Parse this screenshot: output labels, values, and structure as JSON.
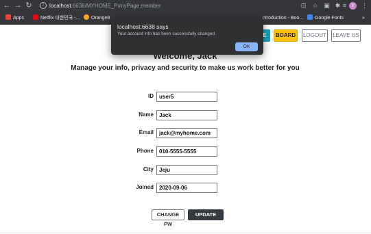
{
  "browser": {
    "url_host": "localhost",
    "url_rest": ":6638/MYHOME_P/myPage.member",
    "bookmarks": [
      {
        "label": "Apps",
        "color": "#e8453c"
      },
      {
        "label": "Netflix 대한민국 -...",
        "color": "#e50914"
      },
      {
        "label": "Orange8",
        "color": "#f5a623"
      },
      {
        "label": "ntroduction - Boo...",
        "color": ""
      },
      {
        "label": "Google Fonts",
        "color": "#4285f4"
      }
    ],
    "overflow": "»",
    "profile_initial": "Y"
  },
  "nav": {
    "teal_label": "E",
    "board_label": "BOARD",
    "logout_label": "LOGOUT",
    "leave_label": "LEAVE US"
  },
  "page": {
    "welcome": "Welcome, Jack",
    "subtitle": "Manage your info, privacy and security to make us work better for you"
  },
  "form": {
    "fields": [
      {
        "label": "ID",
        "value": "user5"
      },
      {
        "label": "Name",
        "value": "Jack"
      },
      {
        "label": "Email",
        "value": "jack@myhome.com"
      },
      {
        "label": "Phone",
        "value": "010-5555-5555"
      },
      {
        "label": "City",
        "value": "Jeju"
      },
      {
        "label": "Joined",
        "value": "2020-09-06"
      }
    ],
    "change_pw_label": "CHANGE PW",
    "update_label": "UPDATE INFO"
  },
  "dialog": {
    "title": "localhost:6638 says",
    "message": "Your account info has been successfully changed.",
    "ok_label": "OK"
  }
}
